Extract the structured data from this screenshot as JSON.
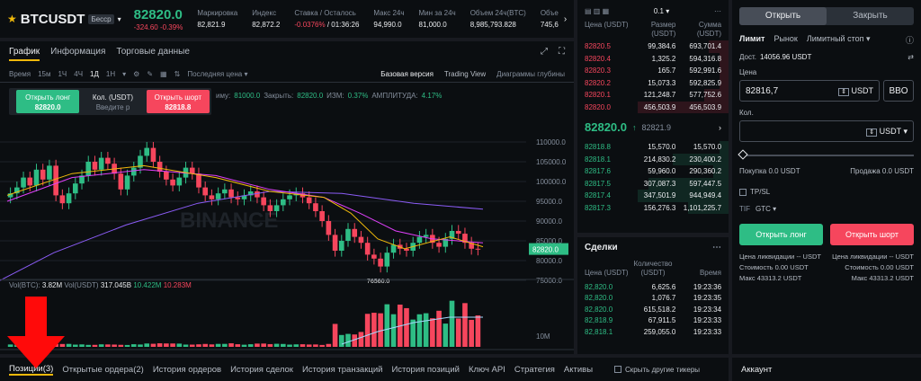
{
  "header": {
    "symbol": "BTCUSDT",
    "type": "Бесср",
    "last": "82820.0",
    "change": "-324.60 -0.39%",
    "stats": [
      {
        "l": "Маркировка",
        "v": "82,821.9"
      },
      {
        "l": "Индекс",
        "v": "82,872.2"
      },
      {
        "l": "Ставка / Осталось",
        "v": "-0.0376% / 01:36:26"
      },
      {
        "l": "Макс 24ч",
        "v": "94,990.0"
      },
      {
        "l": "Мин за 24ч",
        "v": "81,000.0"
      },
      {
        "l": "Объем 24ч(BTC)",
        "v": "8,985,793.828"
      },
      {
        "l": "Объе",
        "v": "745,6"
      }
    ]
  },
  "chart_tabs": [
    "График",
    "Информация",
    "Торговые данные"
  ],
  "intervals": [
    "Время",
    "15м",
    "1Ч",
    "4Ч",
    "1Д",
    "1Н"
  ],
  "price_type": "Последняя цена",
  "views": [
    "Базовая версия",
    "Trading View",
    "Диаграммы глубины"
  ],
  "quick": {
    "long": "Открыть лонг",
    "long_price": "82820.0",
    "qty": "Кол. (USDT)",
    "qty_ph": "Введите р",
    "short": "Открыть шорт",
    "short_price": "82818.8"
  },
  "cinfo": {
    "a": "иму:",
    "b": "81000.0",
    "c": "Закрыть:",
    "d": "82820.0",
    "e": "ИЗМ:",
    "f": "0.37%",
    "g": "АМПЛИТУДА:",
    "h": "4.17%"
  },
  "chart_data": {
    "type": "candlestick",
    "yticks": [
      "110000.0",
      "105000.0",
      "100000.0",
      "95000.0",
      "90000.0",
      "85000.0",
      "80000.0",
      "75000.0"
    ],
    "xticks": [
      "/02",
      "2025",
      "02/01",
      "03/01",
      "04/01"
    ],
    "last_label": "82820.0",
    "low_label": "76560.0",
    "watermark": "BINANCE",
    "vol_label": "Vol(BTC):",
    "vol_btc": "3.82M",
    "vol_usdt_label": "Vol(USDT)",
    "vol_usdt": "317.045B",
    "vol_a": "10.422M",
    "vol_b": "10.283M",
    "vol_tick": "10M"
  },
  "orderbook": {
    "step": "0.1",
    "cols": [
      "Цена (USDT)",
      "Размер (USDT)",
      "Сумма (USDT)"
    ],
    "asks": [
      [
        "82820.5",
        "99,384.6",
        "693,701.4"
      ],
      [
        "82820.4",
        "1,325.2",
        "594,316.8"
      ],
      [
        "82820.3",
        "165.7",
        "592,991.6"
      ],
      [
        "82820.2",
        "15,073.3",
        "592,825.9"
      ],
      [
        "82820.1",
        "121,248.7",
        "577,752.6"
      ],
      [
        "82820.0",
        "456,503.9",
        "456,503.9"
      ]
    ],
    "mid": "82820.0",
    "mid_mark": "82821.9",
    "bids": [
      [
        "82818.8",
        "15,570.0",
        "15,570.0"
      ],
      [
        "82818.1",
        "214,830.2",
        "230,400.2"
      ],
      [
        "82817.6",
        "59,960.0",
        "290,360.2"
      ],
      [
        "82817.5",
        "307,087.3",
        "597,447.5"
      ],
      [
        "82817.4",
        "347,501.9",
        "944,949.4"
      ],
      [
        "82817.3",
        "156,276.3",
        "1,101,225.7"
      ]
    ]
  },
  "trades": {
    "title": "Сделки",
    "cols": [
      "Цена (USDT)",
      "Количество (USDT)",
      "Время"
    ],
    "rows": [
      [
        "82,820.0",
        "6,625.6",
        "19:23:36"
      ],
      [
        "82,820.0",
        "1,076.7",
        "19:23:35"
      ],
      [
        "82,820.0",
        "615,518.2",
        "19:23:34"
      ],
      [
        "82,818.9",
        "67,911.5",
        "19:23:33"
      ],
      [
        "82,818.1",
        "259,055.0",
        "19:23:33"
      ]
    ]
  },
  "form": {
    "open": "Открыть",
    "close": "Закрыть",
    "types": [
      "Лимит",
      "Рынок",
      "Лимитный стоп"
    ],
    "avail_label": "Дост.",
    "avail": "14056.96 USDT",
    "price_label": "Цена",
    "price": "82816,7",
    "unit": "USDT",
    "bbo": "BBO",
    "qty_label": "Кол.",
    "buy": "Покупка 0.0 USDT",
    "sell": "Продажа 0.0 USDT",
    "tpsl": "TP/SL",
    "tif": "TIF",
    "gtc": "GTC",
    "long": "Открыть лонг",
    "short": "Открыть шорт",
    "liq_l": "Цена ликвидации -- USDT",
    "liq_r": "Цена ликвидации -- USDT",
    "cost_l": "Стоимость 0.00 USDT",
    "cost_r": "Стоимость 0.00 USDT",
    "max_l": "Макс 43313.2 USDT",
    "max_r": "Макс 43313.2 USDT"
  },
  "bottom": {
    "tabs": [
      "Позиции(3)",
      "Открытые ордера(2)",
      "История ордеров",
      "История сделок",
      "История транзакций",
      "История позиций",
      "Ключ API",
      "Стратегия",
      "Активы"
    ],
    "hide": "Скрыть другие тикеры",
    "account": "Аккаунт"
  }
}
